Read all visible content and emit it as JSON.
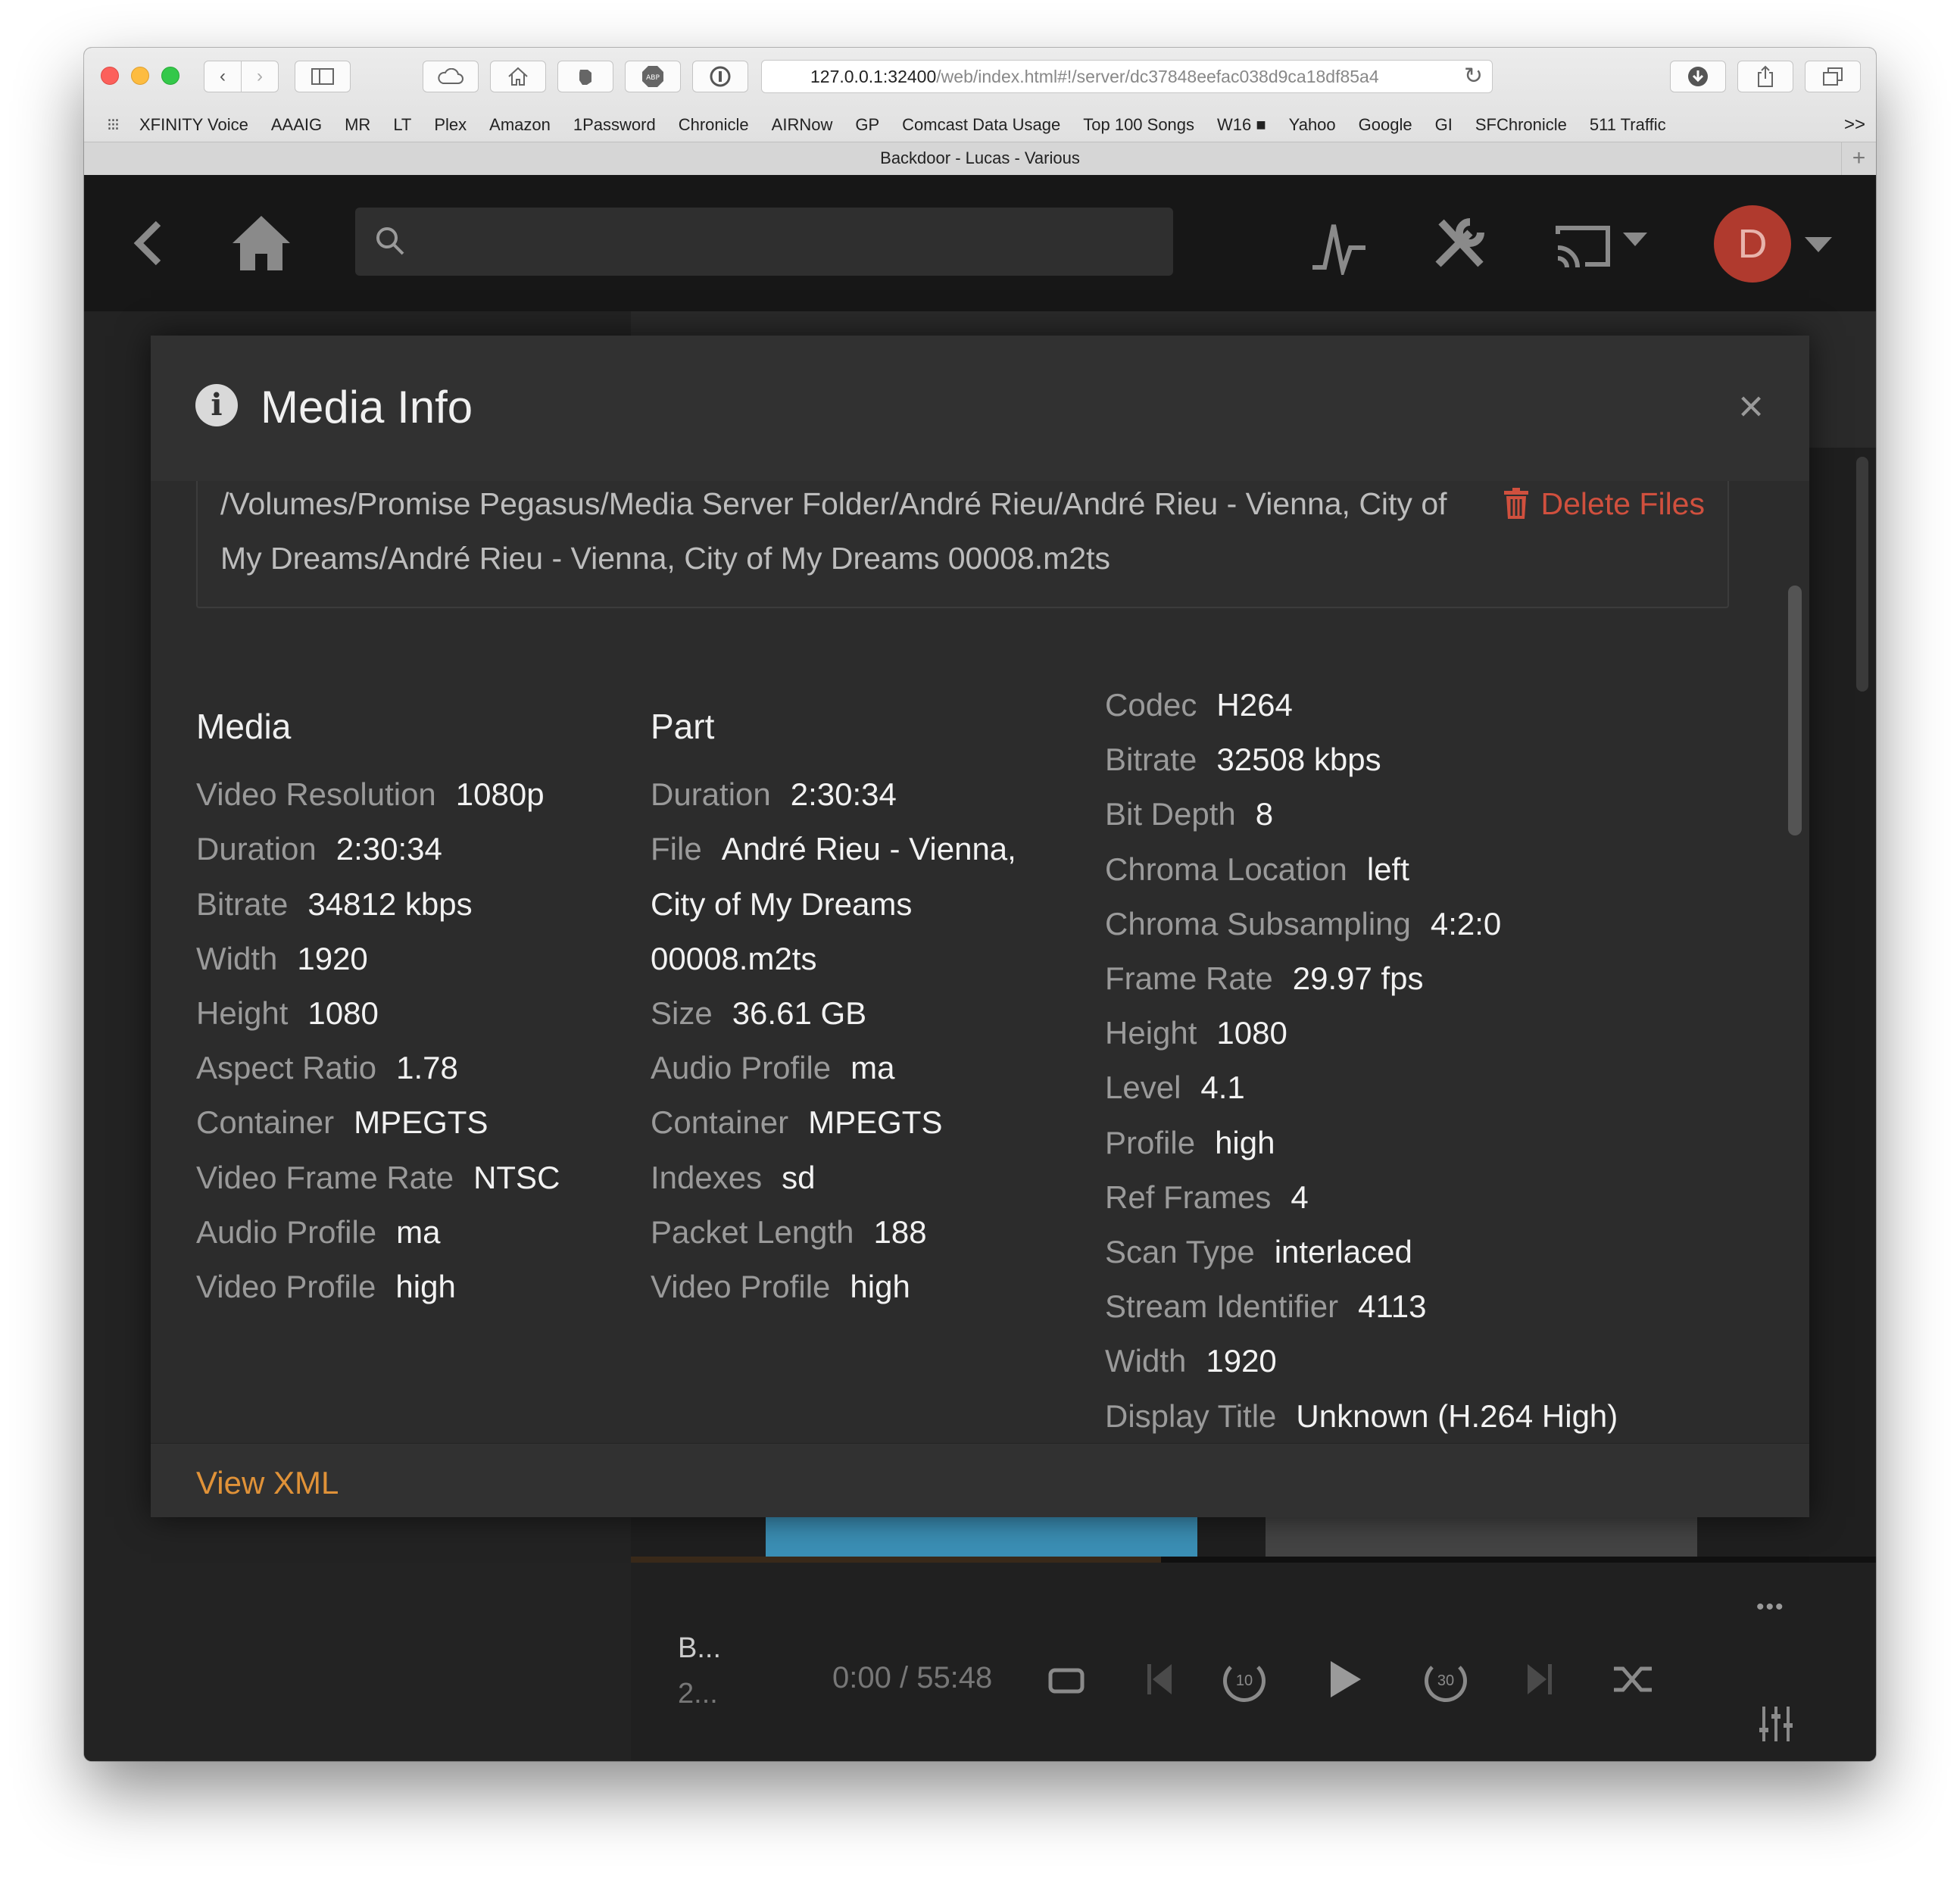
{
  "browser": {
    "url_main": "127.0.0.1:32400",
    "url_rest": "/web/index.html#!/server/dc37848eefac038d9ca18df85a4",
    "bookmarks": [
      "XFINITY Voice",
      "AAAIG",
      "MR",
      "LT",
      "Plex",
      "Amazon",
      "1Password",
      "Chronicle",
      "AIRNow",
      "GP",
      "Comcast Data Usage",
      "Top 100 Songs",
      "W16 ■",
      "Yahoo",
      "Google",
      "GI",
      "SFChronicle",
      "511 Traffic"
    ],
    "overflow": ">>",
    "tab_title": "Backdoor - Lucas - Various",
    "new_tab": "+"
  },
  "app": {
    "avatar_letter": "D"
  },
  "modal": {
    "title": "Media Info",
    "close": "×",
    "path": "/Volumes/Promise Pegasus/Media Server Folder/André Rieu/André Rieu - Vienna, City of My Dreams/André Rieu - Vienna, City of My Dreams 00008.m2ts",
    "delete_label": "Delete Files",
    "media": {
      "heading": "Media",
      "rows": [
        {
          "k": "Video Resolution",
          "v": "1080p"
        },
        {
          "k": "Duration",
          "v": "2:30:34"
        },
        {
          "k": "Bitrate",
          "v": "34812 kbps"
        },
        {
          "k": "Width",
          "v": "1920"
        },
        {
          "k": "Height",
          "v": "1080"
        },
        {
          "k": "Aspect Ratio",
          "v": "1.78"
        },
        {
          "k": "Container",
          "v": "MPEGTS"
        },
        {
          "k": "Video Frame Rate",
          "v": "NTSC"
        },
        {
          "k": "Audio Profile",
          "v": "ma"
        },
        {
          "k": "Video Profile",
          "v": "high"
        }
      ]
    },
    "part": {
      "heading": "Part",
      "duration_k": "Duration",
      "duration_v": "2:30:34",
      "file_k": "File",
      "file_v1": "André Rieu - Vienna,",
      "file_v2": "City of My Dreams",
      "file_v3": "00008.m2ts",
      "rows": [
        {
          "k": "Size",
          "v": "36.61 GB"
        },
        {
          "k": "Audio Profile",
          "v": "ma"
        },
        {
          "k": "Container",
          "v": "MPEGTS"
        },
        {
          "k": "Indexes",
          "v": "sd"
        },
        {
          "k": "Packet Length",
          "v": "188"
        },
        {
          "k": "Video Profile",
          "v": "high"
        }
      ]
    },
    "stream": {
      "rows": [
        {
          "k": "Codec",
          "v": "H264"
        },
        {
          "k": "Bitrate",
          "v": "32508 kbps"
        },
        {
          "k": "Bit Depth",
          "v": "8"
        },
        {
          "k": "Chroma Location",
          "v": "left"
        },
        {
          "k": "Chroma Subsampling",
          "v": "4:2:0"
        },
        {
          "k": "Frame Rate",
          "v": "29.97 fps"
        },
        {
          "k": "Height",
          "v": "1080"
        },
        {
          "k": "Level",
          "v": "4.1"
        },
        {
          "k": "Profile",
          "v": "high"
        },
        {
          "k": "Ref Frames",
          "v": "4"
        },
        {
          "k": "Scan Type",
          "v": "interlaced"
        },
        {
          "k": "Stream Identifier",
          "v": "4113"
        },
        {
          "k": "Width",
          "v": "1920"
        },
        {
          "k": "Display Title",
          "v": "Unknown (H.264 High)"
        }
      ]
    },
    "view_xml": "View XML"
  },
  "player": {
    "title": "B...",
    "subtitle": "2...",
    "time": "0:00 / 55:48",
    "skip_back": "10",
    "skip_fwd": "30",
    "more": "•••"
  }
}
